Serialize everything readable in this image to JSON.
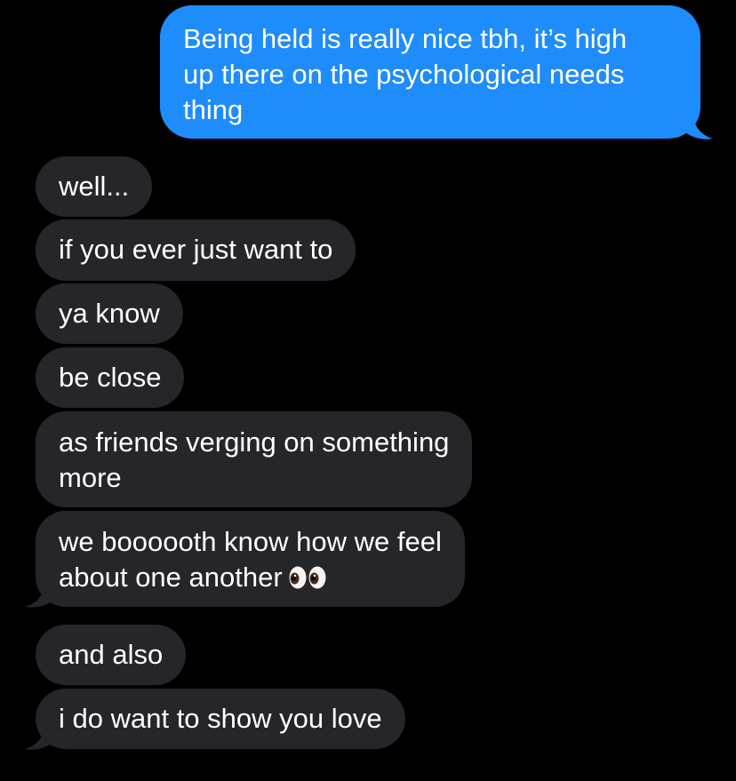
{
  "colors": {
    "background": "#000000",
    "sent_bubble": "#1f8cfb",
    "received_bubble": "#26252a",
    "text": "#ffffff"
  },
  "messages": [
    {
      "direction": "sent",
      "lines": [
        "Being held is really nice tbh, it’s high",
        "up there on the psychological needs",
        "thing"
      ]
    },
    {
      "direction": "received",
      "lines": [
        "well..."
      ]
    },
    {
      "direction": "received",
      "lines": [
        "if you ever just want to"
      ]
    },
    {
      "direction": "received",
      "lines": [
        "ya know"
      ]
    },
    {
      "direction": "received",
      "lines": [
        "be close"
      ]
    },
    {
      "direction": "received",
      "lines": [
        "as friends verging on something",
        "more"
      ]
    },
    {
      "direction": "received",
      "lines": [
        "we boooooth know how we feel",
        "about one another"
      ],
      "emoji": "eyes-emoji"
    },
    {
      "direction": "received",
      "lines": [
        "and also"
      ]
    },
    {
      "direction": "received",
      "lines": [
        "i do want to show you love"
      ]
    }
  ]
}
